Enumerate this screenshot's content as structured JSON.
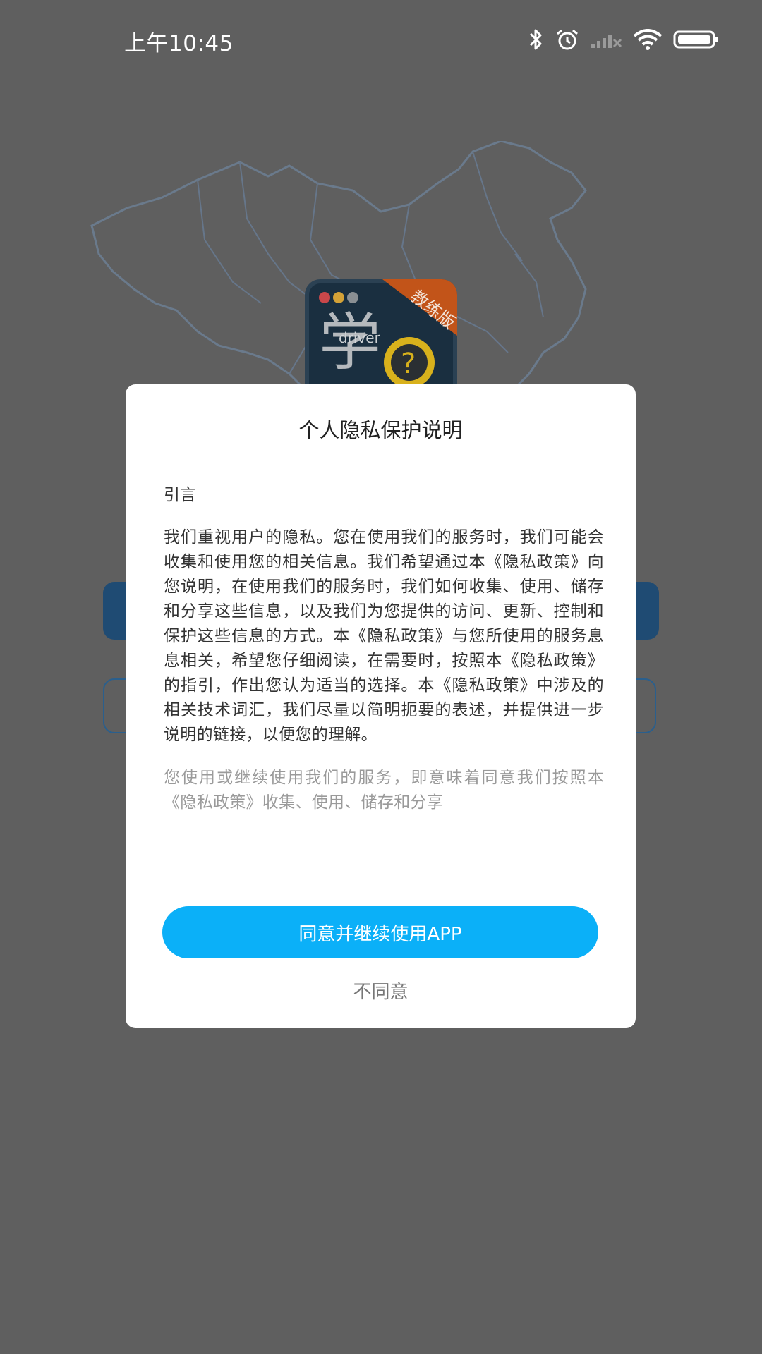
{
  "status_bar": {
    "time": "上午10:45",
    "icons": [
      "bluetooth-icon",
      "alarm-icon",
      "signal-icon",
      "wifi-icon",
      "battery-icon"
    ]
  },
  "background_app": {
    "logo_badge": "教练版",
    "logo_word": "driver"
  },
  "dialog": {
    "title": "个人隐私保护说明",
    "intro_heading": "引言",
    "paragraph_1": "我们重视用户的隐私。您在使用我们的服务时，我们可能会收集和使用您的相关信息。我们希望通过本《隐私政策》向您说明，在使用我们的服务时，我们如何收集、使用、储存和分享这些信息，以及我们为您提供的访问、更新、控制和保护这些信息的方式。本《隐私政策》与您所使用的服务息息相关，希望您仔细阅读，在需要时，按照本《隐私政策》的指引，作出您认为适当的选择。本《隐私政策》中涉及的相关技术词汇，我们尽量以简明扼要的表述，并提供进一步说明的链接，以便您的理解。",
    "paragraph_2": "您使用或继续使用我们的服务，即意味着同意我们按照本《隐私政策》收集、使用、储存和分享",
    "agree_label": "同意并继续使用APP",
    "disagree_label": "不同意"
  },
  "colors": {
    "overlay_bg": "#5f5f5f",
    "agree_button": "#0bb0f8",
    "dialog_bg": "#ffffff",
    "badge_orange": "#d9601f"
  }
}
